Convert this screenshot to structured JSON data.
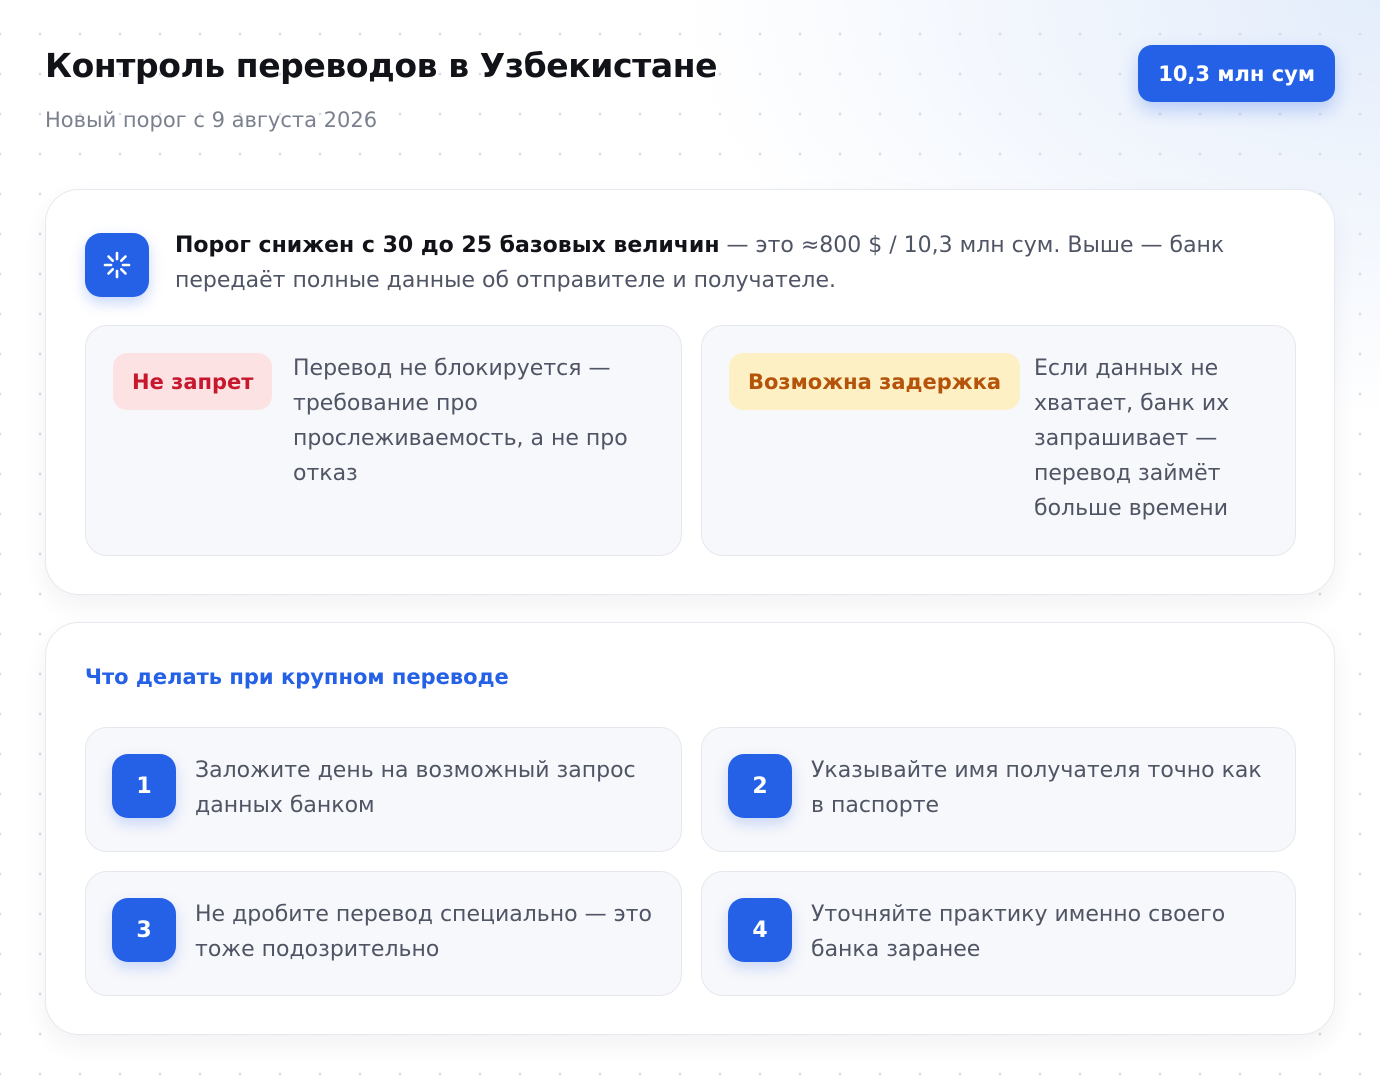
{
  "header": {
    "title": "Контроль переводов в Узбекистане",
    "subtitle": "Новый порог с 9 августа 2026",
    "amount_badge": "10,3 млн сум"
  },
  "info": {
    "icon": "spinner-icon",
    "bold": "Порог снижен с 30 до 25 базовых величин",
    "rest": " — это ≈800 $ / 10,3 млн сум. Выше — банк передаёт полные данные об отправителе и получателе."
  },
  "notes": [
    {
      "tag": "Не запрет",
      "text": "Перевод не блокируется — требование про прослеживаемость, а не про отказ",
      "tag_color": "#c8182d",
      "tag_bg": "#fde2e4"
    },
    {
      "tag": "Возможна задержка",
      "text": "Если данных не хватает, банк их запрашивает — перевод займёт больше времени",
      "tag_color": "#b45309",
      "tag_bg": "#fdf0c4"
    }
  ],
  "steps_section": {
    "title": "Что делать при крупном переводе",
    "items": [
      {
        "num": "1",
        "text": "Заложите день на возможный запрос данных банком"
      },
      {
        "num": "2",
        "text": "Указывайте имя получателя точно как в паспорте"
      },
      {
        "num": "3",
        "text": "Не дробите перевод специально — это тоже подозрительно"
      },
      {
        "num": "4",
        "text": "Уточняйте практику именно своего банка заранее"
      }
    ]
  },
  "colors": {
    "accent": "#2461e6",
    "text_primary": "#111319",
    "text_secondary": "#4f5564"
  }
}
